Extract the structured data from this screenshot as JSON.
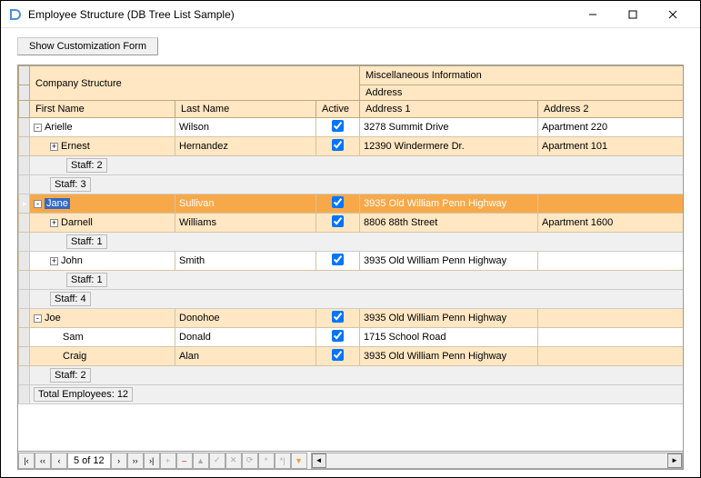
{
  "window": {
    "title": "Employee Structure (DB Tree List Sample)"
  },
  "toolbar": {
    "customize": "Show Customization Form"
  },
  "bands": {
    "company": "Company Structure",
    "misc": "Miscellaneous Information",
    "address": "Address"
  },
  "columns": {
    "firstName": "First Name",
    "lastName": "Last Name",
    "active": "Active",
    "address1": "Address 1",
    "address2": "Address 2"
  },
  "rows": [
    {
      "level": 0,
      "exp": "-",
      "alt": false,
      "fn": "Arielle",
      "ln": "Wilson",
      "active": true,
      "a1": "3278 Summit Drive",
      "a2": "Apartment 220"
    },
    {
      "level": 1,
      "exp": "+",
      "alt": true,
      "fn": "Ernest",
      "ln": "Hernandez",
      "active": true,
      "a1": "12390 Windermere Dr.",
      "a2": "Apartment 101"
    },
    {
      "summaryIndent": 1,
      "summary": "Staff: 2"
    },
    {
      "summaryIndent": 0,
      "summary": "Staff: 3"
    },
    {
      "level": 0,
      "exp": "-",
      "sel": true,
      "fn": "Jane",
      "ln": "Sullivan",
      "active": true,
      "a1": "3935 Old William Penn Highway",
      "a2": ""
    },
    {
      "level": 1,
      "exp": "+",
      "alt": true,
      "fn": "Darnell",
      "ln": "Williams",
      "active": true,
      "a1": "8806 88th Street",
      "a2": "Apartment 1600"
    },
    {
      "summaryIndent": 1,
      "summary": "Staff: 1"
    },
    {
      "level": 1,
      "exp": "+",
      "alt": false,
      "fn": "John",
      "ln": "Smith",
      "active": true,
      "a1": "3935 Old William Penn Highway",
      "a2": ""
    },
    {
      "summaryIndent": 1,
      "summary": "Staff: 1"
    },
    {
      "summaryIndent": 0,
      "summary": "Staff: 4"
    },
    {
      "level": 0,
      "exp": "-",
      "alt": true,
      "fn": "Joe",
      "ln": "Donohoe",
      "active": true,
      "a1": "3935 Old William Penn Highway",
      "a2": ""
    },
    {
      "level": 1,
      "exp": "",
      "alt": false,
      "fn": "Sam",
      "ln": "Donald",
      "active": true,
      "a1": "1715 School Road",
      "a2": ""
    },
    {
      "level": 1,
      "exp": "",
      "alt": true,
      "fn": "Craig",
      "ln": "Alan",
      "active": true,
      "a1": "3935 Old William Penn Highway",
      "a2": ""
    },
    {
      "summaryIndent": 0,
      "summary": "Staff: 2"
    }
  ],
  "footer": {
    "total": "Total Employees: 12"
  },
  "navigator": {
    "page": "5 of 12",
    "first": "|‹",
    "prevPage": "‹‹",
    "prev": "‹",
    "next": "›",
    "nextPage": "››",
    "last": "›|",
    "add": "+",
    "del": "–",
    "edit": "▲",
    "post": "✓",
    "cancel": "✕",
    "refresh": "⟳",
    "bookmark": "*",
    "gotoBookmark": "*|",
    "filter": "▼"
  }
}
